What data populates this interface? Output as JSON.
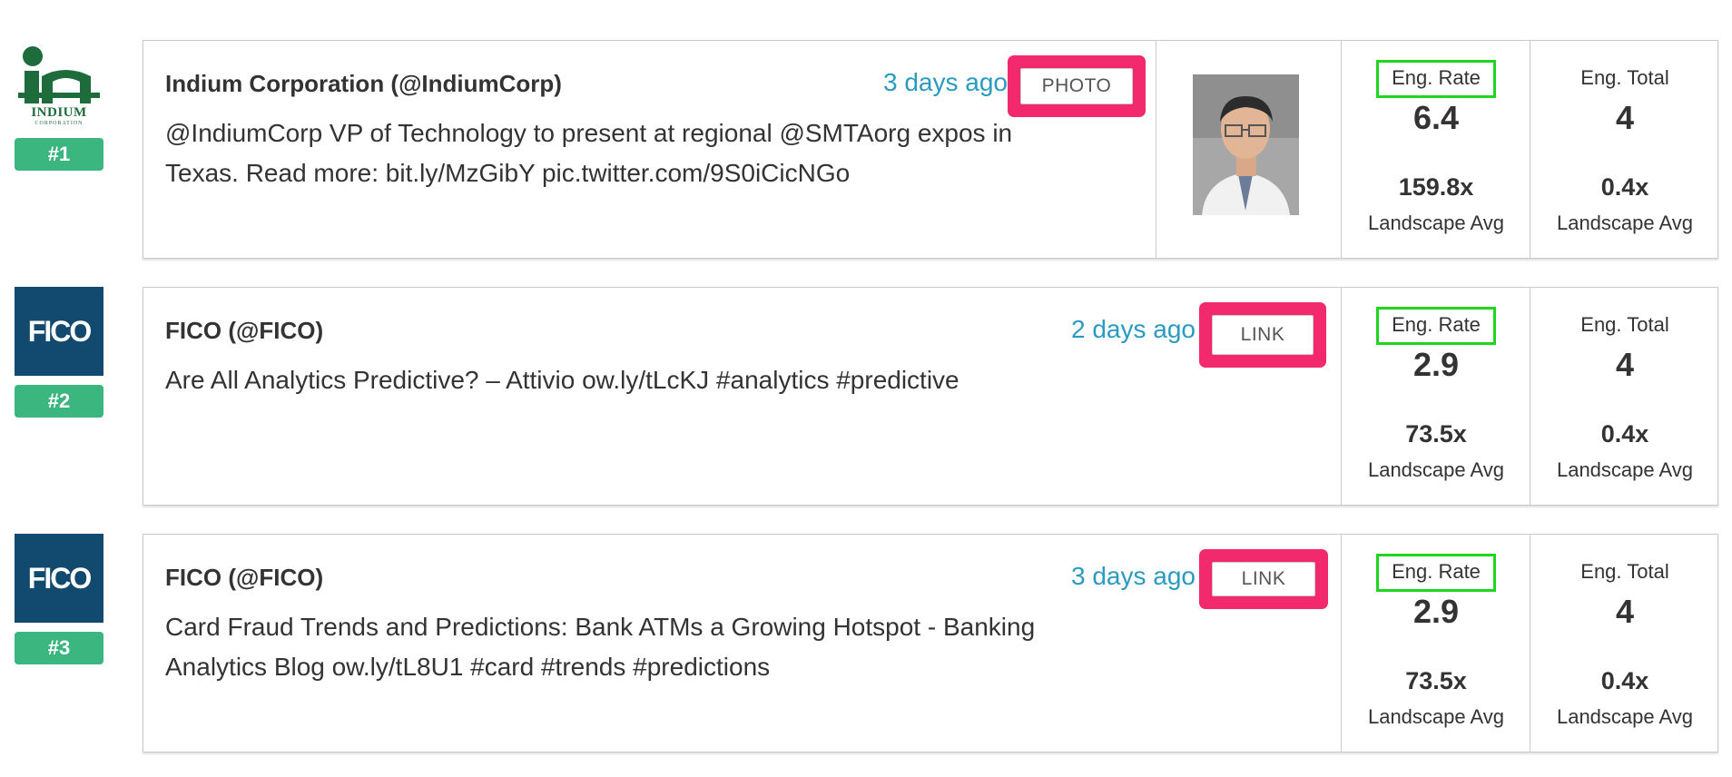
{
  "colors": {
    "link_blue": "#2b9ac0",
    "rank_green": "#3ab67e",
    "highlight_pink": "#f2296c",
    "highlight_green": "#1fd51f",
    "fico_navy": "#114a6e"
  },
  "rows": [
    {
      "logo": {
        "type": "indium",
        "text": "INDIUM",
        "subtext": "CORPORATION"
      },
      "rank": "#1",
      "author": "Indium Corporation (@IndiumCorp)",
      "time": "3 days ago",
      "tag": "PHOTO",
      "text": "@IndiumCorp VP of Technology to present at regional @SMTAorg expos in Texas. Read more: bit.ly/MzGibY pic.twitter.com/9S0iCicNGo",
      "has_photo": true,
      "eng_rate_label": "Eng. Rate",
      "eng_rate": "6.4",
      "eng_rate_mult": "159.8x",
      "eng_rate_sub": "Landscape Avg",
      "eng_total_label": "Eng. Total",
      "eng_total": "4",
      "eng_total_mult": "0.4x",
      "eng_total_sub": "Landscape Avg"
    },
    {
      "logo": {
        "type": "fico",
        "text": "FICO"
      },
      "rank": "#2",
      "author": "FICO (@FICO)",
      "time": "2 days ago",
      "tag": "LINK",
      "text": "Are All Analytics Predictive? – Attivio ow.ly/tLcKJ #analytics #predictive",
      "has_photo": false,
      "eng_rate_label": "Eng. Rate",
      "eng_rate": "2.9",
      "eng_rate_mult": "73.5x",
      "eng_rate_sub": "Landscape Avg",
      "eng_total_label": "Eng. Total",
      "eng_total": "4",
      "eng_total_mult": "0.4x",
      "eng_total_sub": "Landscape Avg"
    },
    {
      "logo": {
        "type": "fico",
        "text": "FICO"
      },
      "rank": "#3",
      "author": "FICO (@FICO)",
      "time": "3 days ago",
      "tag": "LINK",
      "text": "Card Fraud Trends and Predictions: Bank ATMs a Growing Hotspot - Banking Analytics Blog ow.ly/tL8U1 #card #trends #predictions",
      "has_photo": false,
      "eng_rate_label": "Eng. Rate",
      "eng_rate": "2.9",
      "eng_rate_mult": "73.5x",
      "eng_rate_sub": "Landscape Avg",
      "eng_total_label": "Eng. Total",
      "eng_total": "4",
      "eng_total_mult": "0.4x",
      "eng_total_sub": "Landscape Avg"
    }
  ]
}
